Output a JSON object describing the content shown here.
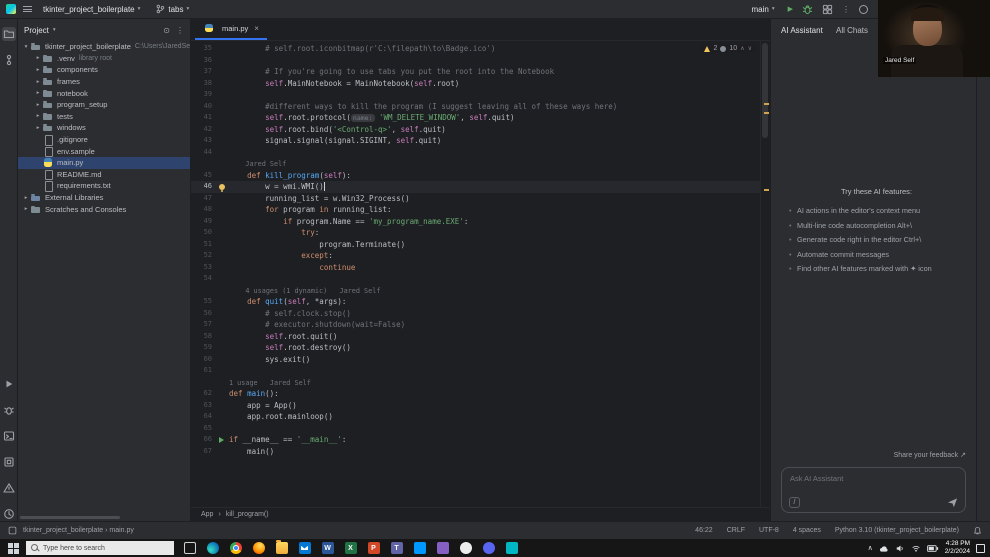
{
  "icons": {
    "chevron_down": "▾",
    "chevron_right": "▸",
    "close": "×",
    "kebab": "⋮",
    "play": "▶",
    "up": "∧",
    "down": "∨",
    "external": "↗",
    "slash": "/",
    "tray_chevron": "∧",
    "breadcrumb_sep": "›",
    "collapse": "⊙"
  },
  "titlebar": {
    "project": "tkinter_project_boilerplate",
    "branch": "tabs",
    "run_config": "main"
  },
  "webcam": {
    "name": "Jared Self"
  },
  "project": {
    "header": "Project",
    "items": [
      {
        "label": "tkinter_project_boilerplate",
        "suffix": "C:\\Users\\JaredSe",
        "icon": "folder",
        "chevron": "down",
        "indent": 0
      },
      {
        "label": ".venv",
        "suffix": "library root",
        "icon": "folder",
        "chevron": "right",
        "indent": 1
      },
      {
        "label": "components",
        "icon": "folder",
        "chevron": "right",
        "indent": 1
      },
      {
        "label": "frames",
        "icon": "folder",
        "chevron": "right",
        "indent": 1
      },
      {
        "label": "notebook",
        "icon": "folder",
        "chevron": "right",
        "indent": 1
      },
      {
        "label": "program_setup",
        "icon": "folder",
        "chevron": "right",
        "indent": 1
      },
      {
        "label": "tests",
        "icon": "folder",
        "chevron": "right",
        "indent": 1
      },
      {
        "label": "windows",
        "icon": "folder",
        "chevron": "right",
        "indent": 1
      },
      {
        "label": ".gitignore",
        "icon": "file",
        "indent": 1
      },
      {
        "label": "env.sample",
        "icon": "file",
        "indent": 1
      },
      {
        "label": "main.py",
        "icon": "python",
        "indent": 1,
        "selected": true
      },
      {
        "label": "README.md",
        "icon": "file",
        "indent": 1
      },
      {
        "label": "requirements.txt",
        "icon": "file",
        "indent": 1
      },
      {
        "label": "External Libraries",
        "icon": "lib",
        "chevron": "right",
        "indent": 0
      },
      {
        "label": "Scratches and Consoles",
        "icon": "folder",
        "chevron": "right",
        "indent": 0
      }
    ]
  },
  "editor": {
    "tab": "main.py",
    "inspections": {
      "warnings": "2",
      "typos": "10"
    },
    "rows": [
      {
        "n": "35",
        "seg": [
          [
            "c",
            "        # self.root.iconbitmap(r'C:\\filepath\\to\\Badge.ico')"
          ]
        ]
      },
      {
        "n": "36",
        "seg": []
      },
      {
        "n": "37",
        "seg": [
          [
            "c",
            "        # If you're going to use tabs you put the root into the Notebook"
          ]
        ]
      },
      {
        "n": "38",
        "seg": [
          [
            "",
            "        "
          ],
          [
            "slf",
            "self"
          ],
          [
            "",
            ".MainNotebook = MainNotebook("
          ],
          [
            "slf",
            "self"
          ],
          [
            "",
            ".root)"
          ]
        ]
      },
      {
        "n": "39",
        "seg": []
      },
      {
        "n": "40",
        "seg": [
          [
            "c",
            "        #different ways to kill the program (I suggest leaving all of these ways here)"
          ]
        ]
      },
      {
        "n": "41",
        "seg": [
          [
            "",
            "        "
          ],
          [
            "slf",
            "self"
          ],
          [
            "",
            ".root.protocol("
          ],
          [
            "hint",
            "name:"
          ],
          [
            "s",
            " 'WM_DELETE_WINDOW'"
          ],
          [
            "",
            ", "
          ],
          [
            "slf",
            "self"
          ],
          [
            "",
            ".quit)"
          ]
        ]
      },
      {
        "n": "42",
        "seg": [
          [
            "",
            "        "
          ],
          [
            "slf",
            "self"
          ],
          [
            "",
            ".root.bind("
          ],
          [
            "s",
            "'<Control-q>'"
          ],
          [
            "",
            ", "
          ],
          [
            "slf",
            "self"
          ],
          [
            "",
            ".quit)"
          ]
        ]
      },
      {
        "n": "43",
        "seg": [
          [
            "",
            "        signal.signal(signal.SIGINT, "
          ],
          [
            "slf",
            "self"
          ],
          [
            "",
            ".quit)"
          ]
        ]
      },
      {
        "n": "44",
        "seg": []
      },
      {
        "n": "",
        "seg": [
          [
            "ann",
            "    Jared Self"
          ]
        ]
      },
      {
        "n": "45",
        "seg": [
          [
            "",
            "    "
          ],
          [
            "k",
            "def "
          ],
          [
            "fn",
            "kill_program"
          ],
          [
            "",
            "("
          ],
          [
            "slf",
            "self"
          ],
          [
            "",
            "):"
          ]
        ]
      },
      {
        "n": "46",
        "cur": true,
        "icon": "bulb",
        "caret": true,
        "seg": [
          [
            "",
            "        w = wmi.WMI()"
          ]
        ]
      },
      {
        "n": "47",
        "seg": [
          [
            "",
            "        running_list = w.Win32_Process()"
          ]
        ]
      },
      {
        "n": "48",
        "seg": [
          [
            "",
            "        "
          ],
          [
            "k",
            "for"
          ],
          [
            "",
            " program "
          ],
          [
            "k",
            "in"
          ],
          [
            "",
            " running_list:"
          ]
        ]
      },
      {
        "n": "49",
        "seg": [
          [
            "",
            "            "
          ],
          [
            "k",
            "if"
          ],
          [
            "",
            " program.Name == "
          ],
          [
            "s",
            "'my_program_name.EXE'"
          ],
          [
            "",
            ":"
          ]
        ]
      },
      {
        "n": "50",
        "seg": [
          [
            "",
            "                "
          ],
          [
            "k",
            "try"
          ],
          [
            "",
            ":"
          ]
        ]
      },
      {
        "n": "51",
        "seg": [
          [
            "",
            "                    program.Terminate()"
          ]
        ]
      },
      {
        "n": "52",
        "seg": [
          [
            "",
            "                "
          ],
          [
            "k",
            "except"
          ],
          [
            "",
            ":"
          ]
        ]
      },
      {
        "n": "53",
        "seg": [
          [
            "",
            "                    "
          ],
          [
            "k",
            "continue"
          ]
        ]
      },
      {
        "n": "54",
        "seg": []
      },
      {
        "n": "",
        "seg": [
          [
            "ann",
            "    4 usages (1 dynamic)   Jared Self"
          ]
        ]
      },
      {
        "n": "55",
        "seg": [
          [
            "",
            "    "
          ],
          [
            "k",
            "def "
          ],
          [
            "fn",
            "quit"
          ],
          [
            "",
            "("
          ],
          [
            "slf",
            "self"
          ],
          [
            "",
            ", *args):"
          ]
        ]
      },
      {
        "n": "56",
        "seg": [
          [
            "c",
            "        # self.clock.stop()"
          ]
        ]
      },
      {
        "n": "57",
        "seg": [
          [
            "c",
            "        # executor.shutdown(wait=False)"
          ]
        ]
      },
      {
        "n": "58",
        "seg": [
          [
            "",
            "        "
          ],
          [
            "slf",
            "self"
          ],
          [
            "",
            ".root.quit()"
          ]
        ]
      },
      {
        "n": "59",
        "seg": [
          [
            "",
            "        "
          ],
          [
            "slf",
            "self"
          ],
          [
            "",
            ".root.destroy()"
          ]
        ]
      },
      {
        "n": "60",
        "seg": [
          [
            "",
            "        sys.exit()"
          ]
        ]
      },
      {
        "n": "61",
        "seg": []
      },
      {
        "n": "",
        "seg": [
          [
            "ann",
            "1 usage   Jared Self"
          ]
        ]
      },
      {
        "n": "62",
        "seg": [
          [
            "k",
            "def "
          ],
          [
            "fn",
            "main"
          ],
          [
            "",
            "():"
          ]
        ]
      },
      {
        "n": "63",
        "seg": [
          [
            "",
            "    app = App()"
          ]
        ]
      },
      {
        "n": "64",
        "seg": [
          [
            "",
            "    app.root.mainloop()"
          ]
        ]
      },
      {
        "n": "65",
        "seg": []
      },
      {
        "n": "66",
        "icon": "run",
        "seg": [
          [
            "k",
            "if"
          ],
          [
            "",
            " __name__ == "
          ],
          [
            "s",
            "'__main__'"
          ],
          [
            "",
            ":"
          ]
        ]
      },
      {
        "n": "67",
        "seg": [
          [
            "",
            "    main()"
          ]
        ]
      }
    ]
  },
  "ai": {
    "title": "AI Assistant",
    "chats": "All Chats",
    "intro": "Try these AI features:",
    "features": [
      "AI actions in the editor's context menu",
      "Multi-line code autocompletion Alt+\\",
      "Generate code right in the editor Ctrl+\\",
      "Automate commit messages",
      "Find other AI features marked with ✦ icon"
    ],
    "feedback": "Share your feedback",
    "placeholder": "Ask AI Assistant"
  },
  "breadcrumbs": {
    "app": "App",
    "method": "kill_program()"
  },
  "status": {
    "left": "tkinter_project_boilerplate › main.py",
    "position": "46:22",
    "line_sep": "CRLF",
    "encoding": "UTF-8",
    "indent": "4 spaces",
    "interpreter": "Python 3.10 (tkinter_project_boilerplate)"
  },
  "taskbar": {
    "search": "Type here to search",
    "time": "4:28 PM",
    "date": "2/2/2024",
    "icons": [
      {
        "name": "task-view"
      },
      {
        "name": "edge"
      },
      {
        "name": "chrome"
      },
      {
        "name": "firefox"
      },
      {
        "name": "file-explorer"
      },
      {
        "name": "mail"
      },
      {
        "name": "word",
        "glyph": "W"
      },
      {
        "name": "excel",
        "glyph": "X"
      },
      {
        "name": "powerpoint",
        "glyph": "P"
      },
      {
        "name": "teams",
        "glyph": "T"
      },
      {
        "name": "vscode"
      },
      {
        "name": "visual-studio"
      },
      {
        "name": "github"
      },
      {
        "name": "discord"
      },
      {
        "name": "photos"
      }
    ]
  }
}
